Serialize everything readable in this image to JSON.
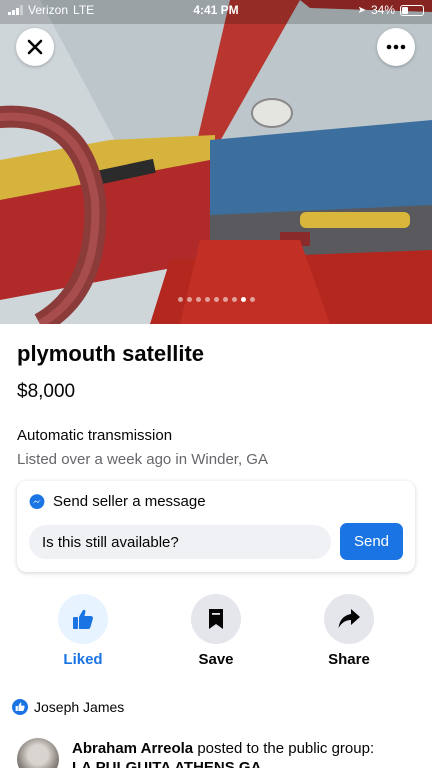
{
  "status_bar": {
    "carrier": "Verizon",
    "network": "LTE",
    "time": "4:41 PM",
    "battery": "34%"
  },
  "photo": {
    "dots_total": 9,
    "active_dot": 8
  },
  "listing": {
    "title": "plymouth satellite",
    "price": "$8,000",
    "detail": "Automatic transmission",
    "listed": "Listed over a week ago in Winder, GA"
  },
  "message": {
    "heading": "Send seller a message",
    "input_value": "Is this still available?",
    "send_label": "Send"
  },
  "actions": {
    "like_label": "Liked",
    "save_label": "Save",
    "share_label": "Share"
  },
  "feed": {
    "liker_name": "Joseph James",
    "post_author": "Abraham Arreola",
    "post_text": "posted to the public group:",
    "group_name": "LA PULGUITA ATHENS GA"
  },
  "colors": {
    "accent": "#1b74e4",
    "liked_bg": "#e7f3ff",
    "action_bg": "#e4e6eb"
  }
}
